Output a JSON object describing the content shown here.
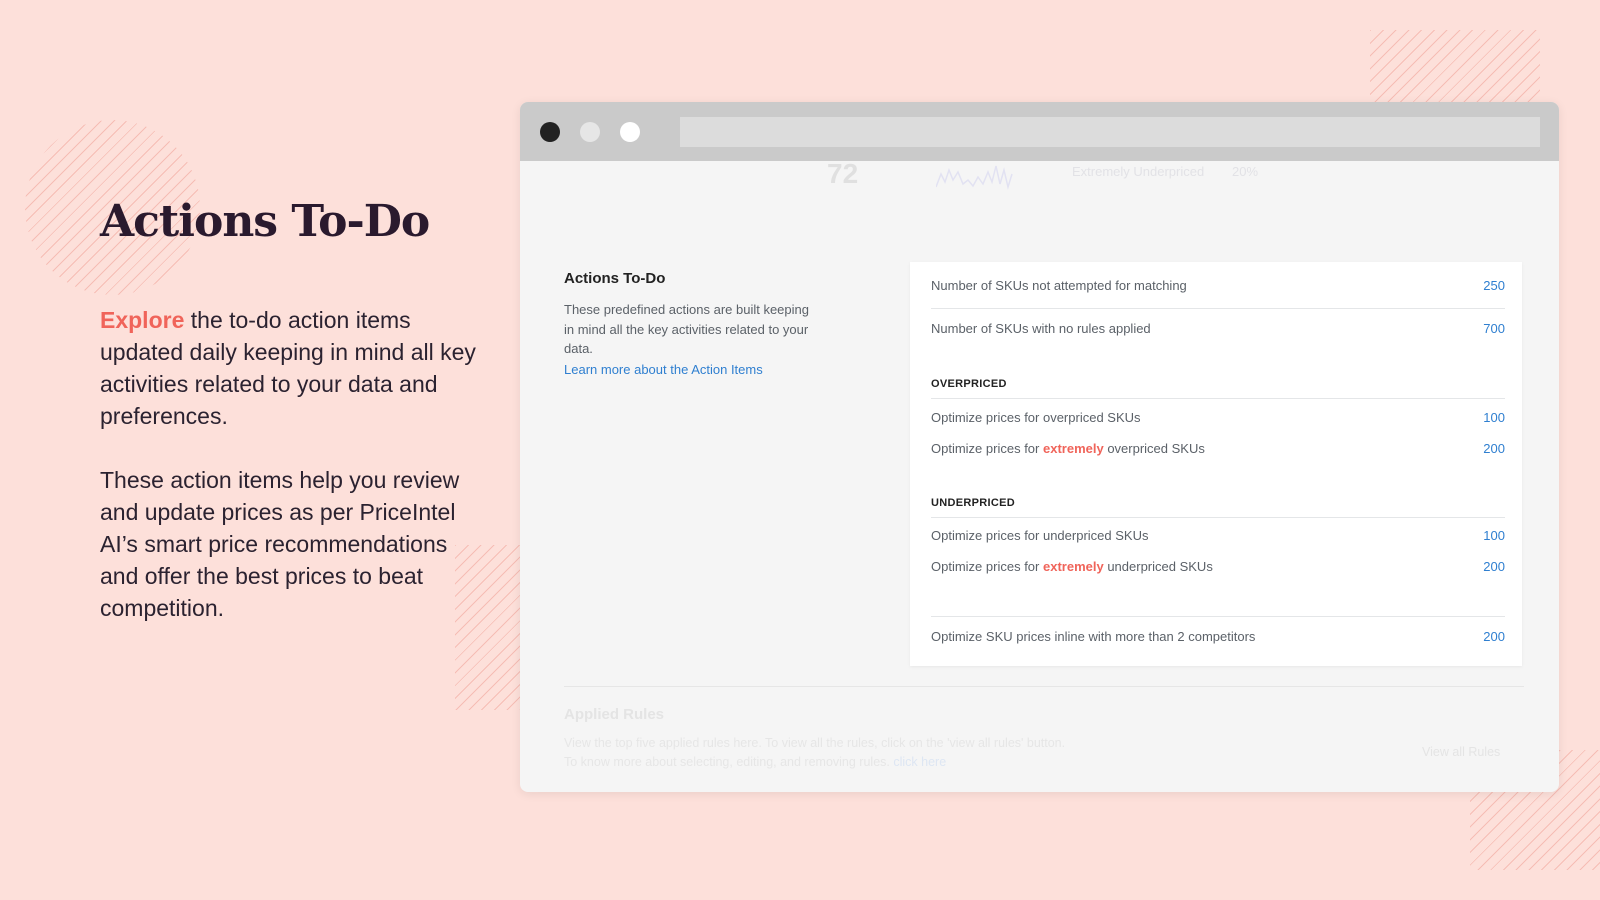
{
  "hero": {
    "title": "Actions To-Do",
    "para1_accent": "Explore",
    "para1_rest": " the to-do action items updated daily keeping in mind all key activities related to your data and preferences.",
    "para2": "These action items help you review and update prices as per PriceIntel AI’s smart price recommendations and offer the best prices to beat competition."
  },
  "window": {
    "ghost_top": {
      "number": "72",
      "label": "Extremely Underpriced",
      "percent": "20%"
    },
    "section": {
      "title": "Actions To-Do",
      "description": "These predefined actions are built keeping in mind all the key activities related to your data.",
      "link": "Learn more about the Action Items"
    },
    "rows": [
      {
        "label": "Number of SKUs not attempted for matching",
        "value": "250"
      },
      {
        "label": "Number of SKUs with no rules applied",
        "value": "700"
      }
    ],
    "overpriced": {
      "header": "OVERPRICED",
      "rows": [
        {
          "pre": "Optimize prices for overpriced SKUs",
          "value": "100"
        },
        {
          "pre": "Optimize prices for ",
          "em": "extremely",
          "post": " overpriced SKUs",
          "value": "200"
        }
      ]
    },
    "underpriced": {
      "header": "UNDERPRICED",
      "rows": [
        {
          "pre": "Optimize prices for underpriced SKUs",
          "value": "100"
        },
        {
          "pre": "Optimize prices for ",
          "em": "extremely",
          "post": " underpriced SKUs",
          "value": "200"
        }
      ]
    },
    "last_row": {
      "label": "Optimize SKU prices inline with more than 2 competitors",
      "value": "200"
    },
    "applied_rules": {
      "title": "Applied Rules",
      "line1": "View the top five applied rules here. To view all the rules, click on the 'view all rules' button.",
      "line2": "To know more about selecting, editing, and removing rules.",
      "link": "click here",
      "button": "View all Rules"
    }
  },
  "colors": {
    "background": "#fde0da",
    "accent": "#f0645a",
    "link": "#2f7fd0"
  }
}
